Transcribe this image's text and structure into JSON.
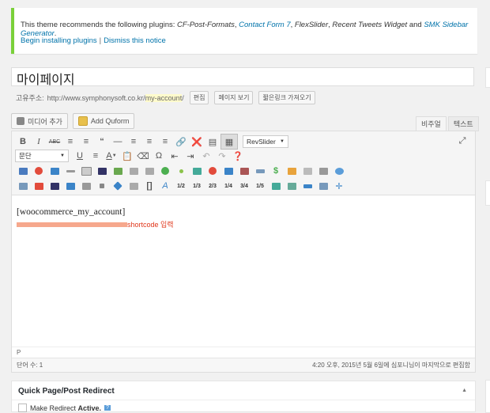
{
  "notice": {
    "prefix": "This theme recommends the following plugins: ",
    "plugins": [
      "CF-Post-Formats",
      "Contact Form 7",
      "FlexSlider",
      "Recent Tweets Widget",
      "SMK Sidebar Generator"
    ],
    "and": " and ",
    "actions": [
      "Begin installing plugins",
      "Dismiss this notice"
    ],
    "separator": "|"
  },
  "post": {
    "title": "마이페이지",
    "permalink_label": "고유주소:",
    "permalink_base": "http://www.symphonysoft.co.kr/",
    "permalink_slug": "my-account",
    "permalink_end": "/",
    "buttons": [
      "편집",
      "페이지 보기",
      "짧은링크 가져오기"
    ]
  },
  "media": {
    "add_media": "미디어 추가",
    "add_quform": "Add Quform"
  },
  "tabs": {
    "visual": "비주얼",
    "text": "텍스트"
  },
  "toolbar": {
    "format_select": "문단",
    "revslider": "RevSlider",
    "fractions": [
      "1/2",
      "1/3",
      "2/3",
      "1/4",
      "3/4",
      "1/5"
    ]
  },
  "editor": {
    "content": "[woocommerce_my_account]",
    "annotation": "shortcode 입력",
    "path": "P",
    "word_count": "단어 수: 1",
    "last_edited": "4:20 오후, 2015년 5월 6일에 심포니님이 마지막으로 편집함"
  },
  "metabox": {
    "title": "Quick Page/Post Redirect",
    "option_label": "Make Redirect ",
    "option_bold": "Active.",
    "help": "?"
  },
  "colors": {
    "notice_border": "#7ad03a",
    "link": "#0073aa",
    "highlight": "#f6a88d",
    "annotation": "#e0361a"
  }
}
